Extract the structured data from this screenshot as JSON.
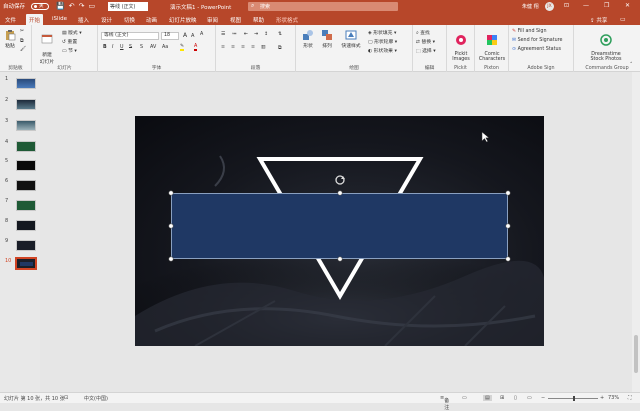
{
  "titlebar": {
    "autosave_label": "自动保存",
    "autosave_state": "关",
    "font_value": "等线 (正文)",
    "doc_title": "演示文稿1 - PowerPoint",
    "search_placeholder": "搜索",
    "user_name": "朱健 翔",
    "avatar_initials": "JX",
    "minimize": "—",
    "restore": "❐",
    "close": "✕"
  },
  "tabs": {
    "file": "文件",
    "home": "开始",
    "islide": "iSlide",
    "insert": "插入",
    "design": "设计",
    "transitions": "切换",
    "animations": "动画",
    "slideshow": "幻灯片放映",
    "review": "审阅",
    "view": "视图",
    "help": "帮助",
    "shape_format": "形状格式",
    "share": "共享"
  },
  "ribbon": {
    "clipboard": {
      "label": "剪贴板",
      "paste": "粘贴"
    },
    "slides": {
      "label": "幻灯片",
      "new_slide": "新建\n幻灯片",
      "reuse": "重用\n幻灯片",
      "layout": "版式",
      "reset": "重置",
      "section": "节"
    },
    "font": {
      "label": "字体",
      "font_name": "等线 (正文)",
      "font_size": "18",
      "bold": "B",
      "italic": "I",
      "underline": "U",
      "strike": "S",
      "grow": "A",
      "shrink": "A",
      "clear": "A",
      "color": "A"
    },
    "paragraph": {
      "label": "段落"
    },
    "drawing": {
      "label": "绘图",
      "shapes": "形状",
      "arrange": "排列",
      "quick_styles": "快速样式",
      "fill": "形状填充",
      "outline": "形状轮廓",
      "effects": "形状效果"
    },
    "editing": {
      "label": "编辑",
      "find": "查找",
      "replace": "替换",
      "select": "选择"
    },
    "pickit": {
      "label": "Pickit",
      "button": "Pickit\nImages"
    },
    "pixton": {
      "label": "Pixton",
      "button": "Comic\nCharacters"
    },
    "adobe_sign": {
      "label": "Adobe Sign",
      "fill_sign": "Fill and Sign",
      "send_sig": "Send for Signature",
      "agreement": "Agreement Status"
    },
    "commands": {
      "label": "Commands Group",
      "button": "Dreamstime\nStock Photos"
    }
  },
  "slides_panel": {
    "numbers": [
      "1",
      "2",
      "3",
      "4",
      "5",
      "6",
      "7",
      "8",
      "9",
      "10"
    ],
    "selected_index": 10
  },
  "status": {
    "slide_info": "幻灯片 第 10 张，共 10 张",
    "language": "中文(中国)",
    "notes": "备注",
    "zoom": "73%"
  },
  "colors": {
    "accent": "#b7472a",
    "rect_fill": "#1f3864",
    "slide_bg": "#15171e",
    "triangle": "#ffffff"
  }
}
